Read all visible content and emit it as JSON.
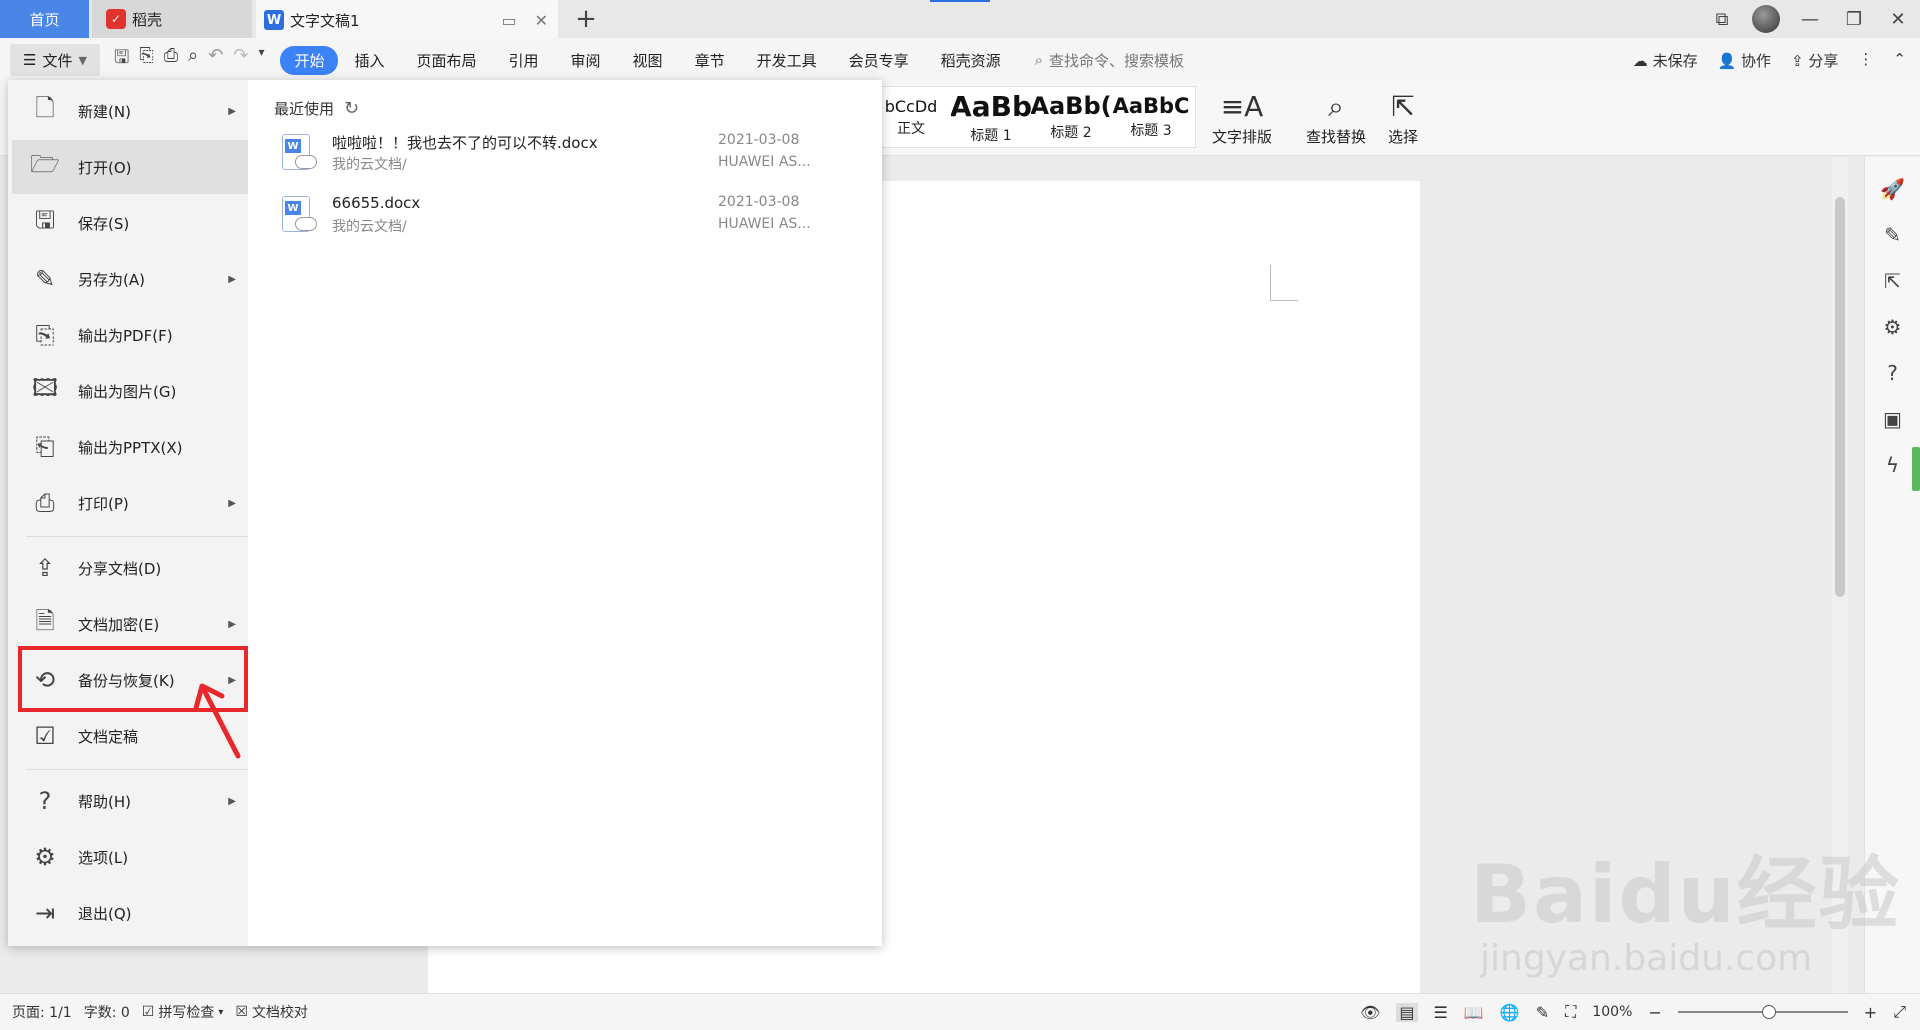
{
  "titlebar": {
    "tabs": {
      "home": "首页",
      "daoke": "稻壳",
      "doc": "文字文稿1"
    }
  },
  "menubar": {
    "file": "文件",
    "items": [
      "开始",
      "插入",
      "页面布局",
      "引用",
      "审阅",
      "视图",
      "章节",
      "开发工具",
      "会员专享",
      "稻壳资源"
    ],
    "search": "查找命令、搜索模板",
    "right": {
      "unsaved": "未保存",
      "collab": "协作",
      "share": "分享"
    }
  },
  "ribbon": {
    "styles": [
      {
        "preview": "bCcDd",
        "caption": "正文"
      },
      {
        "preview": "AaBb",
        "caption": "标题 1"
      },
      {
        "preview": "AaBb(",
        "caption": "标题 2"
      },
      {
        "preview": "AaBbC",
        "caption": "标题 3"
      }
    ],
    "text_layout": "文字排版",
    "find_replace": "查找替换",
    "select": "选择"
  },
  "file_menu": {
    "items": [
      {
        "label": "新建(N)",
        "icon": "new-doc-icon",
        "has_submenu": true
      },
      {
        "label": "打开(O)",
        "icon": "folder-icon",
        "has_submenu": false
      },
      {
        "label": "保存(S)",
        "icon": "save-icon",
        "has_submenu": false
      },
      {
        "label": "另存为(A)",
        "icon": "save-as-icon",
        "has_submenu": true
      },
      {
        "label": "输出为PDF(F)",
        "icon": "pdf-icon",
        "has_submenu": false
      },
      {
        "label": "输出为图片(G)",
        "icon": "image-icon",
        "has_submenu": false
      },
      {
        "label": "输出为PPTX(X)",
        "icon": "pptx-icon",
        "has_submenu": false
      },
      {
        "label": "打印(P)",
        "icon": "print-icon",
        "has_submenu": true
      },
      {
        "label": "分享文档(D)",
        "icon": "share-icon",
        "has_submenu": false
      },
      {
        "label": "文档加密(E)",
        "icon": "encrypt-icon",
        "has_submenu": true
      },
      {
        "label": "备份与恢复(K)",
        "icon": "backup-icon",
        "has_submenu": true
      },
      {
        "label": "文档定稿",
        "icon": "finalize-icon",
        "has_submenu": false
      },
      {
        "label": "帮助(H)",
        "icon": "help-icon",
        "has_submenu": true
      },
      {
        "label": "选项(L)",
        "icon": "gear-icon",
        "has_submenu": false
      },
      {
        "label": "退出(Q)",
        "icon": "exit-icon",
        "has_submenu": false
      }
    ],
    "recent_title": "最近使用",
    "recent_files": [
      {
        "name": "啦啦啦！！我也去不了的可以不转.docx",
        "location": "我的云文档/",
        "date": "2021-03-08",
        "device": "HUAWEI AS..."
      },
      {
        "name": "66655.docx",
        "location": "我的云文档/",
        "date": "2021-03-08",
        "device": "HUAWEI AS..."
      }
    ]
  },
  "statusbar": {
    "page": "页面: 1/1",
    "words": "字数: 0",
    "spell": "拼写检查",
    "proofread": "文档校对",
    "zoom": "100%"
  },
  "watermark": {
    "main": "Baidu经验",
    "sub": "jingyan.baidu.com"
  },
  "colors": {
    "accent": "#3b82f6",
    "highlight": "#e8282a"
  }
}
